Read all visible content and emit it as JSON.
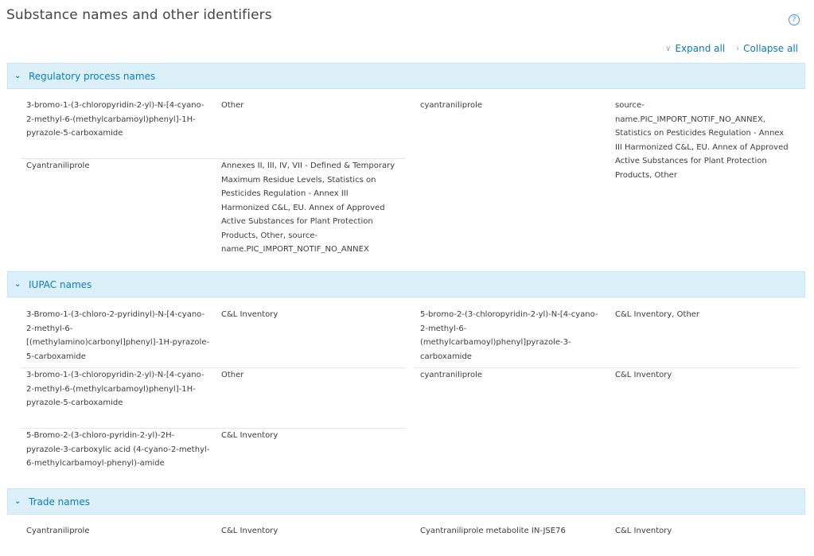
{
  "page": {
    "title": "Substance names and other identifiers",
    "help_icon_glyph": "?"
  },
  "toolbar": {
    "expand_label": "Expand all",
    "collapse_label": "Collapse all",
    "expand_icon": "chevron-down-icon",
    "collapse_icon": "chevron-right-icon"
  },
  "sections": [
    {
      "label": "Regulatory process names",
      "rows_left": [
        {
          "name": "3-bromo-1-(3-chloropyridin-2-yl)-N-[4-cyano-2-methyl-6-(methylcarbamoyl)phenyl]-1H-pyrazole-5-carboxamide",
          "source": "Other"
        },
        {
          "name": "Cyantraniliprole",
          "source": "Annexes II, III, IV, VII - Defined & Temporary Maximum Residue Levels, Statistics on Pesticides Regulation - Annex III Harmonized C&L, EU. Annex of Approved Active Substances for Plant Protection Products, Other, source-name.PIC_IMPORT_NOTIF_NO_ANNEX"
        }
      ],
      "rows_right": [
        {
          "name": "cyantraniliprole",
          "source": "source-name.PIC_IMPORT_NOTIF_NO_ANNEX, Statistics on Pesticides Regulation - Annex III Harmonized C&L, EU. Annex of Approved Active Substances for Plant Protection Products, Other"
        }
      ]
    },
    {
      "label": "IUPAC names",
      "rows_left": [
        {
          "name": "3-Bromo-1-(3-chloro-2-pyridinyl)-N-[4-cyano-2-methyl-6-[(methylamino)carbonyl]phenyl]-1H-pyrazole-5-carboxamide",
          "source": "C&L Inventory"
        },
        {
          "name": "3-bromo-1-(3-chloropyridin-2-yl)-N-[4-cyano-2-methyl-6-(methylcarbamoyl)phenyl]-1H-pyrazole-5-carboxamide",
          "source": "Other"
        },
        {
          "name": "5-Bromo-2-(3-chloro-pyridin-2-yl)-2H-pyrazole-3-carboxylic acid (4-cyano-2-methyl-6-methylcarbamoyl-phenyl)-amide",
          "source": "C&L Inventory"
        }
      ],
      "rows_right": [
        {
          "name": "5-bromo-2-(3-chloropyridin-2-yl)-N-[4-cyano-2-methyl-6-(methylcarbamoyl)phenyl]pyrazole-3-carboxamide",
          "source": "C&L Inventory, Other"
        },
        {
          "name": "cyantraniliprole",
          "source": "C&L Inventory"
        }
      ]
    },
    {
      "label": "Trade names",
      "rows_left": [
        {
          "name": "Cyantraniliprole",
          "source": "C&L Inventory"
        }
      ],
      "rows_right": [
        {
          "name": "Cyantraniliprole metabolite IN-JSE76",
          "source": "C&L Inventory"
        }
      ]
    }
  ],
  "colors": {
    "accent": "#0a7bbf",
    "header_bg": "#dcf0fa",
    "text": "#3c3c3c"
  }
}
